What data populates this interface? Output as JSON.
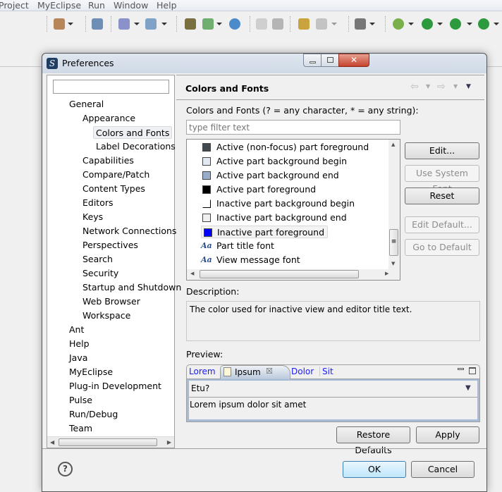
{
  "menubar": {
    "items": [
      "Project",
      "MyEclipse",
      "Run",
      "Window",
      "Help"
    ]
  },
  "dialog": {
    "title": "Preferences",
    "filter_value": "",
    "tree": [
      {
        "label": "General",
        "level": 0
      },
      {
        "label": "Appearance",
        "level": 1
      },
      {
        "label": "Colors and Fonts",
        "level": 2,
        "selected": true
      },
      {
        "label": "Label Decorations",
        "level": 2
      },
      {
        "label": "Capabilities",
        "level": 1
      },
      {
        "label": "Compare/Patch",
        "level": 1
      },
      {
        "label": "Content Types",
        "level": 1
      },
      {
        "label": "Editors",
        "level": 1
      },
      {
        "label": "Keys",
        "level": 1
      },
      {
        "label": "Network Connections",
        "level": 1
      },
      {
        "label": "Perspectives",
        "level": 1
      },
      {
        "label": "Search",
        "level": 1
      },
      {
        "label": "Security",
        "level": 1
      },
      {
        "label": "Startup and Shutdown",
        "level": 1
      },
      {
        "label": "Web Browser",
        "level": 1
      },
      {
        "label": "Workspace",
        "level": 1
      },
      {
        "label": "Ant",
        "level": 0
      },
      {
        "label": "Help",
        "level": 0
      },
      {
        "label": "Java",
        "level": 0
      },
      {
        "label": "MyEclipse",
        "level": 0
      },
      {
        "label": "Plug-in Development",
        "level": 0
      },
      {
        "label": "Pulse",
        "level": 0
      },
      {
        "label": "Run/Debug",
        "level": 0
      },
      {
        "label": "Team",
        "level": 0
      }
    ],
    "page": {
      "title": "Colors and Fonts",
      "filter_label": "Colors and Fonts (? = any character, * = any string):",
      "filter_placeholder": "type filter text",
      "items": [
        {
          "label": "Active (non-focus) part foreground",
          "kind": "color",
          "color": "#414a51"
        },
        {
          "label": "Active part background begin",
          "kind": "color",
          "color": "#e3e9f2"
        },
        {
          "label": "Active part background end",
          "kind": "color",
          "color": "#97adc9"
        },
        {
          "label": "Active part foreground",
          "kind": "color",
          "color": "#000000"
        },
        {
          "label": "Inactive part background begin",
          "kind": "color",
          "color": "#ffffff"
        },
        {
          "label": "Inactive part background end",
          "kind": "color",
          "color": "#f0f0f0"
        },
        {
          "label": "Inactive part foreground",
          "kind": "color",
          "color": "#0000ff",
          "selected": true
        },
        {
          "label": "Part title font",
          "kind": "font"
        },
        {
          "label": "View message font",
          "kind": "font"
        }
      ],
      "font_icon_text": "Aa",
      "buttons": {
        "edit": "Edit...",
        "use_system_font": "Use System Font",
        "reset": "Reset",
        "edit_default": "Edit Default...",
        "go_to_default": "Go to Default"
      },
      "description_label": "Description:",
      "description": "The color used for inactive view and editor title text.",
      "preview_label": "Preview:",
      "preview": {
        "tabs": [
          "Lorem",
          "Ipsum",
          "Dolor",
          "Sit"
        ],
        "active_tab": "Ipsum",
        "combo_value": "Etu?",
        "body_text": "Lorem ipsum dolor sit amet"
      },
      "restore_defaults": "Restore Defaults",
      "apply": "Apply"
    },
    "ok": "OK",
    "cancel": "Cancel",
    "help_icon_text": "?"
  }
}
